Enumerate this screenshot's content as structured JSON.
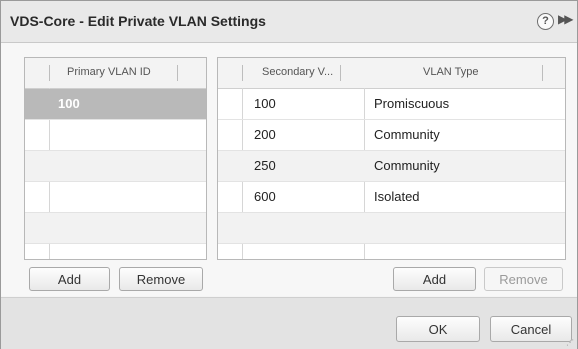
{
  "dialog": {
    "title": "VDS-Core - Edit Private VLAN Settings",
    "help_glyph": "?",
    "expand_glyph": "▶▶"
  },
  "primary_grid": {
    "header": "Primary VLAN ID",
    "rows": [
      "100",
      "",
      "",
      "",
      "",
      ""
    ],
    "selected_index": 0
  },
  "secondary_grid": {
    "headers": [
      "Secondary V...",
      "VLAN Type"
    ],
    "rows": [
      {
        "id": "100",
        "type": "Promiscuous"
      },
      {
        "id": "200",
        "type": "Community"
      },
      {
        "id": "250",
        "type": "Community"
      },
      {
        "id": "600",
        "type": "Isolated"
      },
      {
        "id": "",
        "type": ""
      },
      {
        "id": "",
        "type": ""
      }
    ]
  },
  "buttons": {
    "primary_add": "Add",
    "primary_remove": "Remove",
    "secondary_add": "Add",
    "secondary_remove": "Remove",
    "ok": "OK",
    "cancel": "Cancel"
  },
  "icons": {
    "help": "help-icon",
    "expand": "expand-icon",
    "resize": "resize-grip-icon"
  }
}
